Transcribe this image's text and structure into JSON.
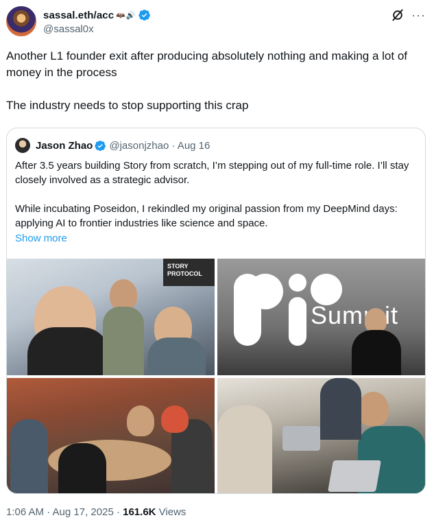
{
  "author": {
    "display_name": "sassal.eth/acc",
    "name_emoji": "🦇🔊",
    "handle": "@sassal0x"
  },
  "tweet": {
    "paragraphs": [
      "Another L1 founder exit after producing absolutely nothing and making a lot of money in the process",
      "The industry needs to stop supporting this crap"
    ]
  },
  "quote": {
    "display_name": "Jason Zhao",
    "meta": "@jasonjzhao · Aug 16",
    "paragraphs": [
      "After 3.5 years building Story from scratch, I’m stepping out of my full-time role. I’ll stay closely involved as a strategic advisor.",
      "While incubating Poseidon, I rekindled my original passion from my DeepMind days: applying AI to frontier industries like science and space."
    ],
    "show_more": "Show more",
    "images": [
      {
        "sign_text": "STORY PROTOCOL"
      },
      {
        "stage_text": "Summit"
      },
      {},
      {}
    ]
  },
  "footer": {
    "time": "1:06 AM · Aug 17, 2025 · ",
    "views_count": "161.6K",
    "views_label": " Views"
  },
  "colors": {
    "accent": "#1d9bf0",
    "secondary_text": "#536471",
    "border": "#cfd9de"
  },
  "icons": [
    "verified-badge-icon",
    "grok-icon",
    "more-options-icon"
  ]
}
